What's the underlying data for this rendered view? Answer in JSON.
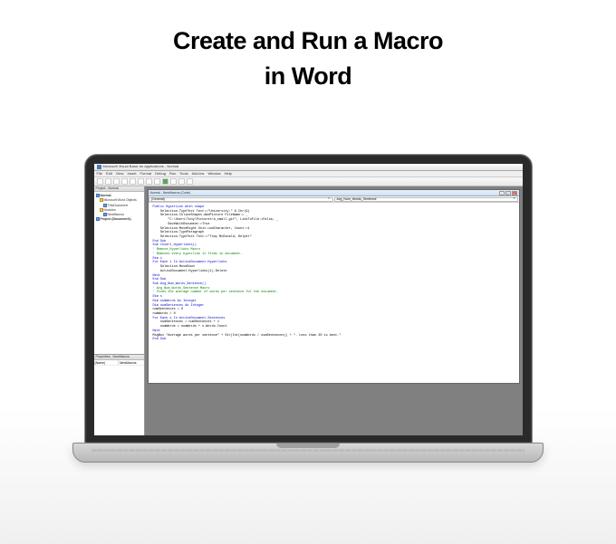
{
  "headline": {
    "line1": "Create and Run a Macro",
    "line2": "in Word"
  },
  "vba": {
    "title": "Microsoft Visual Basic for Applications - Normal",
    "menu": [
      "File",
      "Edit",
      "View",
      "Insert",
      "Format",
      "Debug",
      "Run",
      "Tools",
      "Add-Ins",
      "Window",
      "Help"
    ],
    "project_panel_title": "Project - Normal",
    "tree": {
      "root": "Normal",
      "modules_folder": "Modules",
      "objects_folder": "Microsoft Word Objects",
      "this_doc": "ThisDocument",
      "module": "NewMacros",
      "proj2": "Project (Document1)"
    },
    "props_panel_title": "Properties - NewMacros",
    "props_name_label": "(Name)",
    "props_name_value": "NewMacros",
    "code_window_title": "Normal - NewMacros (Code)",
    "dd_left": "(General)",
    "dd_right": "Avg_Num_Words_Sentence",
    "code": {
      "l1": "Public HyperLink With shape",
      "l2": "    Selection.TypeText Text:=\"University:\" & Chr(9)",
      "l3": "    Selection.InlineShapes.AddPicture FileName:= _",
      "l4": "        \"C:\\Users\\Tony\\Pictures\\h_small.gif\", LinkToFile:=False, _",
      "l5": "        SaveWithDocument:=True",
      "l6": "    Selection.MoveRight Unit:=wdCharacter, Count:=1",
      "l7": "    Selection.TypeParagraph",
      "l8": "    Selection.TypeText Text:=\"Tony McDonald, Helper\"",
      "l9a": "End Sub",
      "l9": "Sub Insert_Hyperlinks()",
      "c1": "' Remove_Hyperlinks Macro",
      "c2": "' Removes every hyperlink it finds in document.",
      "l10": "Dim i",
      "l11": "For Each i In ActiveDocument.Hyperlinks",
      "l12": "    Selection.MoveDown",
      "l13": "    ActiveDocument.Hyperlinks(1).Delete",
      "l14": "Next",
      "l15a": "End Sub",
      "l15": "Sub Avg_Num_Words_Sentence()",
      "c3": "' Avg_Num_Words_Sentence Macro",
      "c4": "' Finds the average number of words per sentence for the document.",
      "l16": "Dim s",
      "l17": "Dim numWords As Integer",
      "l18": "Dim numSentences As Integer",
      "l19": "numSentences = 0",
      "l20": "numWords = 0",
      "l21": "For Each s In ActiveDocument.Sentences",
      "l22": "    numSentences = numSentences + 1",
      "l23": "    numWords = numWords + s.Words.Count",
      "l24": "Next",
      "l25": "MsgBox \"Average words per sentence\" + Str(Int(numWords / numSentences)) + \". Less than 20 is best.\"",
      "l26": "End Sub"
    }
  }
}
